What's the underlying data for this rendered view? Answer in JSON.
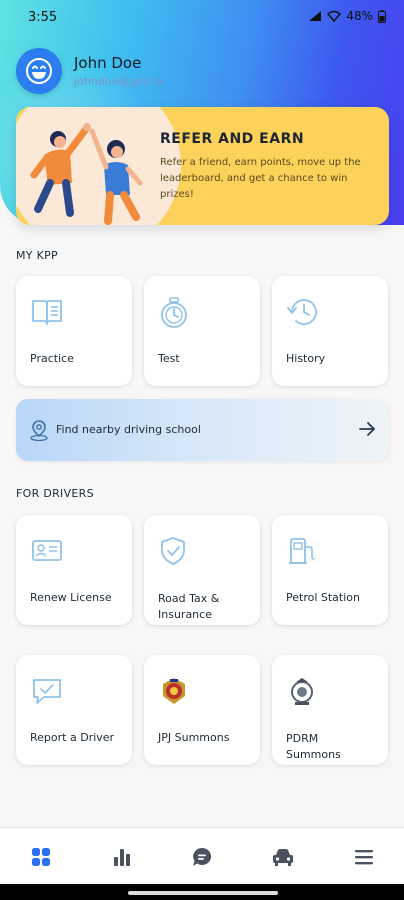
{
  "status_bar": {
    "time": "3:55",
    "battery": "48%"
  },
  "profile": {
    "name": "John Doe",
    "email": "johndoe@gml.la"
  },
  "refer": {
    "title": "REFER AND EARN",
    "description": "Refer a friend, earn points, move up the leaderboard, and get a chance to win prizes!"
  },
  "my_kpp": {
    "title": "MY KPP",
    "tiles": [
      {
        "label": "Practice",
        "icon": "book-icon"
      },
      {
        "label": "Test",
        "icon": "stopwatch-icon"
      },
      {
        "label": "History",
        "icon": "history-icon"
      }
    ]
  },
  "finder": {
    "label": "Find nearby driving school",
    "icon": "location-pin-icon",
    "arrow_icon": "arrow-right-icon"
  },
  "for_drivers": {
    "title": "FOR DRIVERS",
    "tiles": [
      {
        "label": "Renew License",
        "icon": "id-card-icon"
      },
      {
        "label_line1": "Road Tax &",
        "label_line2": "Insurance",
        "icon": "shield-check-icon"
      },
      {
        "label": "Petrol Station",
        "icon": "fuel-pump-icon"
      },
      {
        "label": "Report a Driver",
        "icon": "report-chat-icon"
      },
      {
        "label": "JPJ Summons",
        "icon": "jpj-emblem-icon"
      },
      {
        "label_line1": "PDRM",
        "label_line2": "Summons",
        "icon": "pdrm-emblem-icon"
      }
    ]
  },
  "bottom_nav": [
    {
      "name": "home",
      "icon": "grid-icon",
      "active": true
    },
    {
      "name": "stats",
      "icon": "bar-chart-icon",
      "active": false
    },
    {
      "name": "chat",
      "icon": "chat-bubble-icon",
      "active": false
    },
    {
      "name": "car",
      "icon": "car-icon",
      "active": false
    },
    {
      "name": "menu",
      "icon": "menu-icon",
      "active": false
    }
  ],
  "colors": {
    "accent": "#2c6ff0",
    "icon_light": "#8ec2ea",
    "refer_bg": "#fdd25a"
  }
}
